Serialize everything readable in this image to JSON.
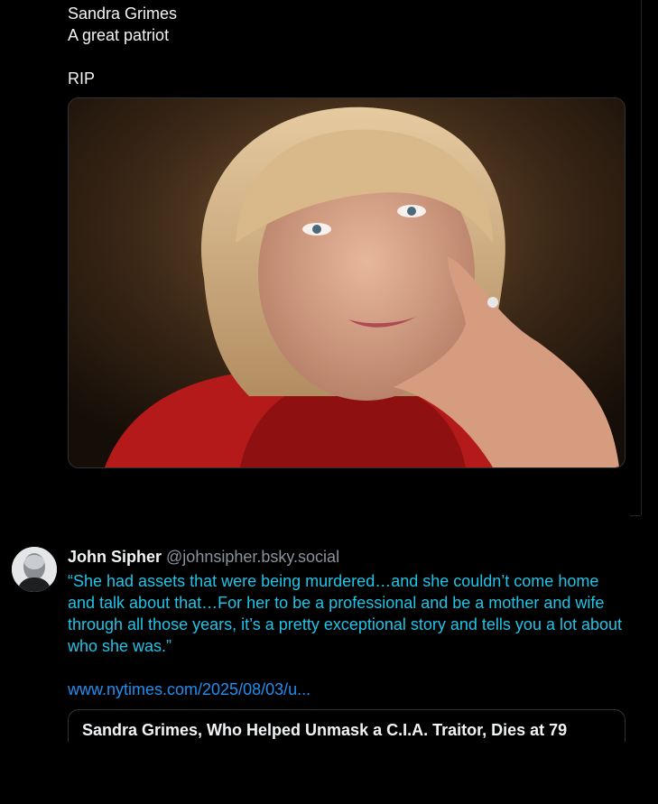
{
  "post": {
    "lines": [
      "Sandra Grimes",
      "A great patriot",
      "RIP"
    ]
  },
  "reply": {
    "author_name": "John Sipher",
    "author_handle": "@johnsipher.bsky.social",
    "quote": "“She had assets that were being murdered…and she couldn’t come home and talk about that…For her to be a professional and be a mother and wife through all those years, it’s a pretty exceptional story and tells you a lot about who she was.”",
    "link": "www.nytimes.com/2025/08/03/u...",
    "card_title": "Sandra Grimes, Who Helped Unmask a C.I.A. Traitor, Dies at 79"
  },
  "icons": [
    "portrait-photo",
    "avatar-photo"
  ],
  "colors": {
    "background": "#000000",
    "text": "#f1f3f5",
    "quote_text": "#20c4e8",
    "link": "#1f8ff0",
    "handle": "#8a939c"
  }
}
